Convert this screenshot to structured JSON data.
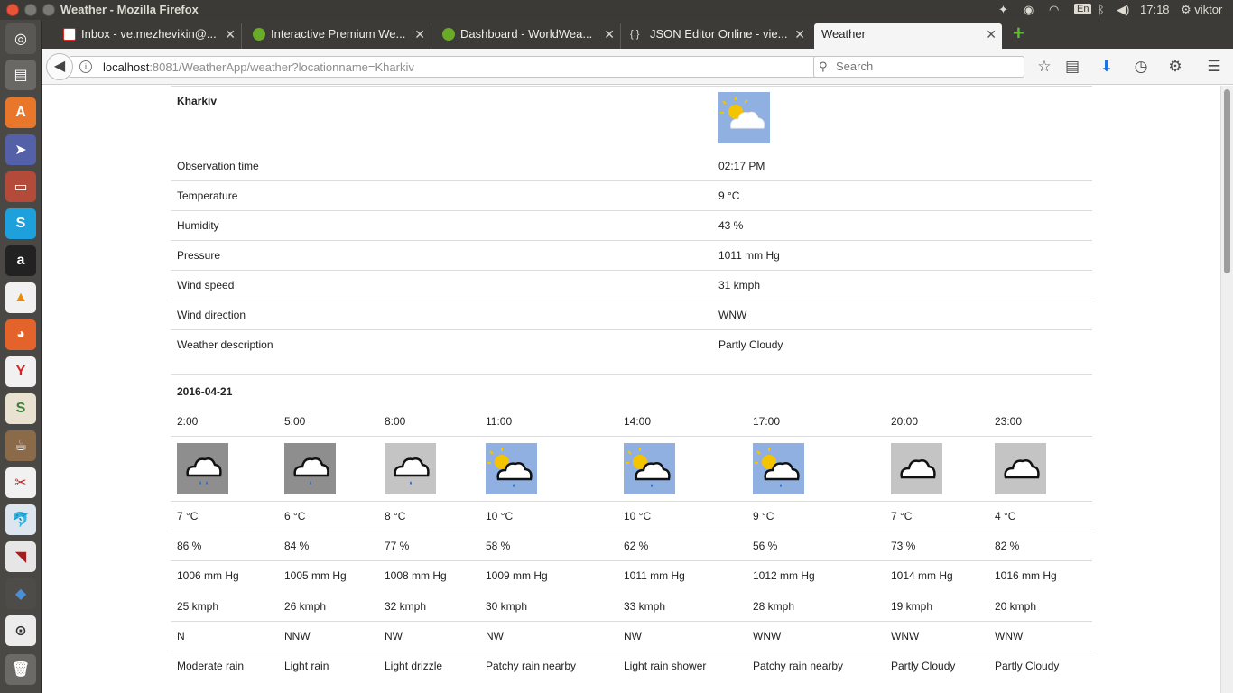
{
  "os": {
    "window_title": "Weather - Mozilla Firefox",
    "keyboard_layout": "En",
    "clock": "17:18",
    "user": "viktor"
  },
  "browser": {
    "tabs": [
      {
        "label": "Inbox - ve.mezhevikin@...",
        "favicon": "gmail-icon",
        "color": "#d93025"
      },
      {
        "label": "Interactive Premium We...",
        "favicon": "worldweather-icon",
        "color": "#6aab2a"
      },
      {
        "label": "Dashboard - WorldWea...",
        "favicon": "worldweather-icon",
        "color": "#6aab2a"
      },
      {
        "label": "JSON Editor Online - vie...",
        "favicon": "json-icon",
        "color": "#dddddd"
      },
      {
        "label": "Weather",
        "favicon": "",
        "color": ""
      }
    ],
    "url_host": "localhost",
    "url_rest": ":8081/WeatherApp/weather?locationname=Kharkiv",
    "search_placeholder": "Search"
  },
  "current": {
    "location": "Kharkiv",
    "icon": "partly-cloudy",
    "rows": [
      {
        "label": "Observation time",
        "value": "02:17 PM"
      },
      {
        "label": "Temperature",
        "value": "9 °C"
      },
      {
        "label": "Humidity",
        "value": "43 %"
      },
      {
        "label": "Pressure",
        "value": "1011 mm Hg"
      },
      {
        "label": "Wind speed",
        "value": "31 kmph"
      },
      {
        "label": "Wind direction",
        "value": "WNW"
      },
      {
        "label": "Weather description",
        "value": "Partly Cloudy"
      }
    ]
  },
  "forecast": {
    "date": "2016-04-21",
    "hours": [
      {
        "time": "2:00",
        "icon": "moderate-rain",
        "temp": "7 °C",
        "humidity": "86 %",
        "pressure": "1006 mm Hg",
        "wind_speed": "25 kmph",
        "wind_dir": "N",
        "desc": "Moderate rain"
      },
      {
        "time": "5:00",
        "icon": "light-rain",
        "temp": "6 °C",
        "humidity": "84 %",
        "pressure": "1005 mm Hg",
        "wind_speed": "26 kmph",
        "wind_dir": "NNW",
        "desc": "Light rain"
      },
      {
        "time": "8:00",
        "icon": "light-drizzle",
        "temp": "8 °C",
        "humidity": "77 %",
        "pressure": "1008 mm Hg",
        "wind_speed": "32 kmph",
        "wind_dir": "NW",
        "desc": "Light drizzle"
      },
      {
        "time": "11:00",
        "icon": "patchy-rain",
        "temp": "10 °C",
        "humidity": "58 %",
        "pressure": "1009 mm Hg",
        "wind_speed": "30 kmph",
        "wind_dir": "NW",
        "desc": "Patchy rain nearby"
      },
      {
        "time": "14:00",
        "icon": "light-rain-shower",
        "temp": "10 °C",
        "humidity": "62 %",
        "pressure": "1011 mm Hg",
        "wind_speed": "33 kmph",
        "wind_dir": "NW",
        "desc": "Light rain shower"
      },
      {
        "time": "17:00",
        "icon": "patchy-rain",
        "temp": "9 °C",
        "humidity": "56 %",
        "pressure": "1012 mm Hg",
        "wind_speed": "28 kmph",
        "wind_dir": "WNW",
        "desc": "Patchy rain nearby"
      },
      {
        "time": "20:00",
        "icon": "cloudy",
        "temp": "7 °C",
        "humidity": "73 %",
        "pressure": "1014 mm Hg",
        "wind_speed": "19 kmph",
        "wind_dir": "WNW",
        "desc": "Partly Cloudy"
      },
      {
        "time": "23:00",
        "icon": "cloudy",
        "temp": "4 °C",
        "humidity": "82 %",
        "pressure": "1016 mm Hg",
        "wind_speed": "20 kmph",
        "wind_dir": "WNW",
        "desc": "Partly Cloudy"
      }
    ]
  },
  "colors": {
    "icon_sky_blue": "#8fb0e0",
    "icon_dark_gray": "#8e8e8e",
    "icon_light_gray": "#c4c4c4",
    "sun": "#f5c400",
    "rain_drop": "#2b6cd6"
  }
}
